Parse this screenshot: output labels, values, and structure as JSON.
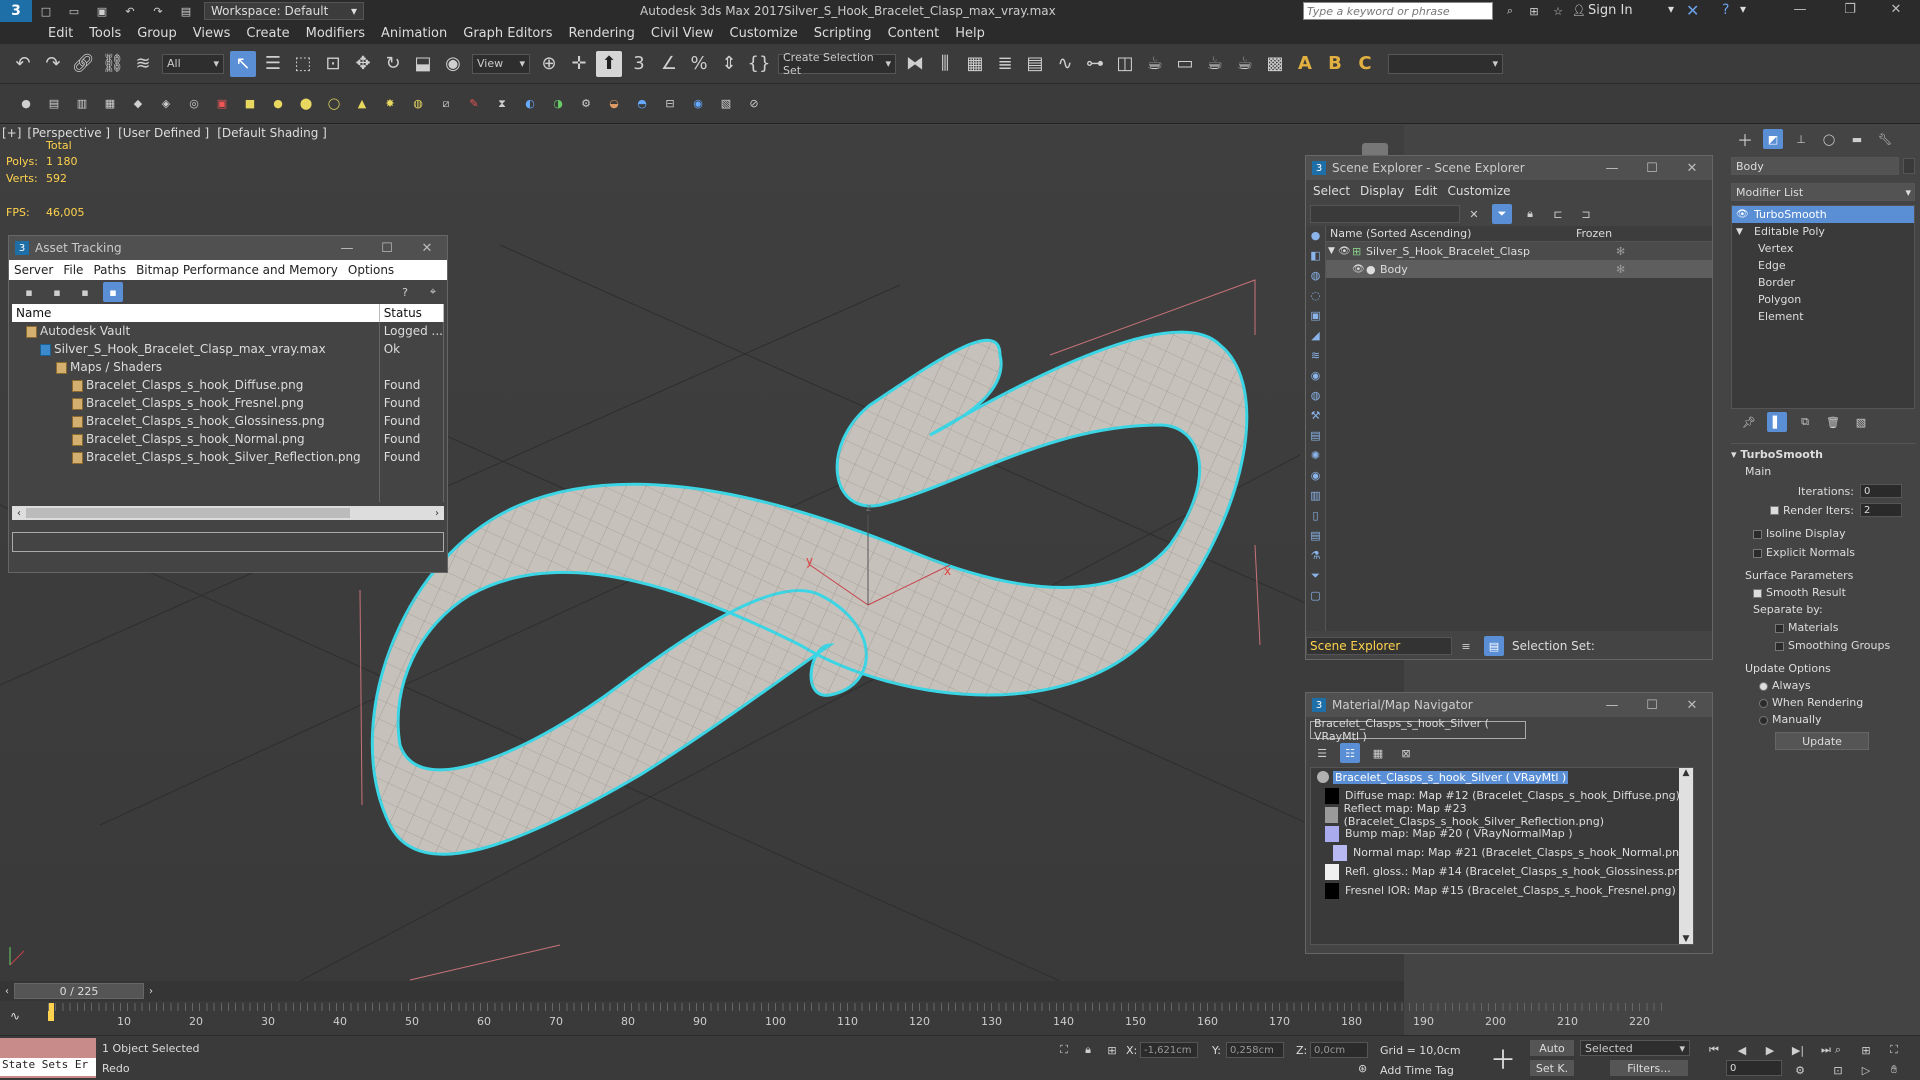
{
  "app": {
    "window_title": "Autodesk 3ds Max 2017",
    "file_title": "Silver_S_Hook_Bracelet_Clasp_max_vray.max",
    "workspace": "Workspace: Default",
    "search_placeholder": "Type a keyword or phrase",
    "sign_in": "Sign In",
    "colors": {
      "accent": "#5a8fd6",
      "selection": "#3ad6e6",
      "stats": "#ffd34d"
    }
  },
  "menu": [
    "Edit",
    "Tools",
    "Group",
    "Views",
    "Create",
    "Modifiers",
    "Animation",
    "Graph Editors",
    "Rendering",
    "Civil View",
    "Customize",
    "Scripting",
    "Content",
    "Help"
  ],
  "toolbar": {
    "filter": "All",
    "ref_coord": "View",
    "selection_set": "Create Selection Set"
  },
  "viewport": {
    "labels": [
      "[+]",
      "[Perspective ]",
      "[User Defined ]",
      "[Default Shading ]"
    ],
    "stats": {
      "total": "Total",
      "polys_label": "Polys:",
      "polys": "1 180",
      "verts_label": "Verts:",
      "verts": "592",
      "fps_label": "FPS:",
      "fps": "46,005"
    },
    "axis": {
      "x": "x",
      "y": "y",
      "z": "z"
    }
  },
  "asset_tracking": {
    "title": "Asset Tracking",
    "menu": [
      "Server",
      "File",
      "Paths",
      "Bitmap Performance and Memory",
      "Options"
    ],
    "columns": [
      "Name",
      "Status"
    ],
    "rows": [
      {
        "name": "Autodesk Vault",
        "status": "Logged ...",
        "indent": 1
      },
      {
        "name": "Silver_S_Hook_Bracelet_Clasp_max_vray.max",
        "status": "Ok",
        "indent": 2
      },
      {
        "name": "Maps / Shaders",
        "status": "",
        "indent": 3
      },
      {
        "name": "Bracelet_Clasps_s_hook_Diffuse.png",
        "status": "Found",
        "indent": 4
      },
      {
        "name": "Bracelet_Clasps_s_hook_Fresnel.png",
        "status": "Found",
        "indent": 4
      },
      {
        "name": "Bracelet_Clasps_s_hook_Glossiness.png",
        "status": "Found",
        "indent": 4
      },
      {
        "name": "Bracelet_Clasps_s_hook_Normal.png",
        "status": "Found",
        "indent": 4
      },
      {
        "name": "Bracelet_Clasps_s_hook_Silver_Reflection.png",
        "status": "Found",
        "indent": 4
      }
    ]
  },
  "scene_explorer": {
    "title": "Scene Explorer - Scene Explorer",
    "menu": [
      "Select",
      "Display",
      "Edit",
      "Customize"
    ],
    "col_name": "Name (Sorted Ascending)",
    "col_frozen": "Frozen",
    "items": [
      {
        "name": "Silver_S_Hook_Bracelet_Clasp",
        "selected": false
      },
      {
        "name": "Body",
        "selected": true
      }
    ],
    "footer_label": "Scene Explorer",
    "selection_set": "Selection Set:"
  },
  "material_navigator": {
    "title": "Material/Map Navigator",
    "current": "Bracelet_Clasps_s_hook_Silver  ( VRayMtl )",
    "root": "Bracelet_Clasps_s_hook_Silver  ( VRayMtl )",
    "maps": [
      {
        "label": "Diffuse map: Map #12 (Bracelet_Clasps_s_hook_Diffuse.png)",
        "swatch": "#000000",
        "indent": 0
      },
      {
        "label": "Reflect map: Map #23 (Bracelet_Clasps_s_hook_Silver_Reflection.png)",
        "swatch": "#9a9a9a",
        "indent": 0
      },
      {
        "label": "Bump map: Map #20  ( VRayNormalMap )",
        "swatch": "#aaaaee",
        "indent": 0
      },
      {
        "label": "Normal map: Map #21 (Bracelet_Clasps_s_hook_Normal.png)",
        "swatch": "#b8b8f2",
        "indent": 1
      },
      {
        "label": "Refl. gloss.: Map #14 (Bracelet_Clasps_s_hook_Glossiness.png)",
        "swatch": "#f0f0f0",
        "indent": 0
      },
      {
        "label": "Fresnel IOR: Map #15 (Bracelet_Clasps_s_hook_Fresnel.png)",
        "swatch": "#000000",
        "indent": 0
      }
    ]
  },
  "command_panel": {
    "object_name": "Body",
    "modifier_list": "Modifier List",
    "stack": [
      {
        "name": "TurboSmooth",
        "selected": true,
        "level": 0
      },
      {
        "name": "Editable Poly",
        "selected": false,
        "level": 0
      },
      {
        "name": "Vertex",
        "selected": false,
        "level": 1
      },
      {
        "name": "Edge",
        "selected": false,
        "level": 1
      },
      {
        "name": "Border",
        "selected": false,
        "level": 1
      },
      {
        "name": "Polygon",
        "selected": false,
        "level": 1
      },
      {
        "name": "Element",
        "selected": false,
        "level": 1
      }
    ],
    "turbosmooth": {
      "title": "TurboSmooth",
      "main": "Main",
      "iterations_label": "Iterations:",
      "iterations": "0",
      "render_iters_label": "Render Iters:",
      "render_iters": "2",
      "isoline": "Isoline Display",
      "explicit_normals": "Explicit Normals",
      "surface_params": "Surface Parameters",
      "smooth_result": "Smooth Result",
      "separate_by": "Separate by:",
      "materials": "Materials",
      "smoothing_groups": "Smoothing Groups",
      "update_options": "Update Options",
      "always": "Always",
      "when_rendering": "When Rendering",
      "manually": "Manually",
      "update_button": "Update"
    }
  },
  "timeline": {
    "frame": "0 / 225",
    "ticks": [
      "10",
      "20",
      "30",
      "40",
      "50",
      "60",
      "70",
      "80",
      "90",
      "100",
      "110",
      "120",
      "130",
      "140",
      "150",
      "160",
      "170",
      "180",
      "190",
      "200",
      "210",
      "220"
    ]
  },
  "status": {
    "state_sets": "State Sets Er",
    "selected": "1 Object Selected",
    "prompt": "Redo",
    "x_label": "X:",
    "x": "-1,621cm",
    "y_label": "Y:",
    "y": "0,258cm",
    "z_label": "Z:",
    "z": "0,0cm",
    "grid": "Grid = 10,0cm",
    "add_time_tag": "Add Time Tag",
    "auto": "Auto",
    "set_k": "Set K.",
    "selected_dd": "Selected",
    "filters": "Filters...",
    "frame_field": "0"
  }
}
